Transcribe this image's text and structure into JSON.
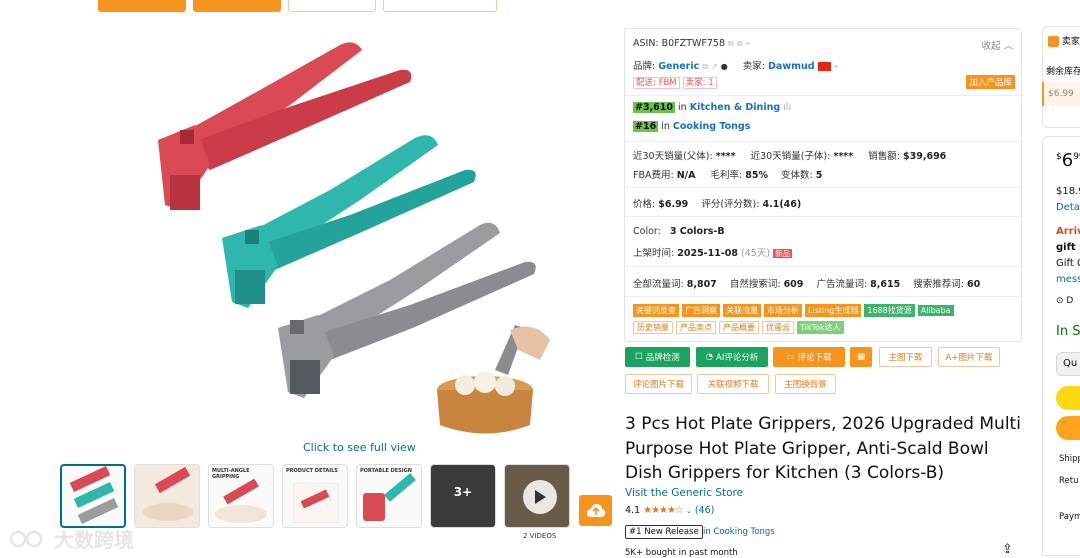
{
  "top_buttons": [
    {
      "color": "#f7941d"
    },
    {
      "color": "#f7941d"
    },
    {
      "color": "#fff"
    },
    {
      "color": "#fff"
    }
  ],
  "gallery": {
    "see_full": "Click to see full view",
    "thumbs": [
      "thumb-red-teal",
      "thumb-hand",
      "thumb-multi-angle",
      "thumb-product-details",
      "thumb-portable-design",
      "thumb-more",
      "thumb-video"
    ],
    "thumb_texts": {
      "multi_angle": "MULTI-ANGLE GRIPPING",
      "details": "PRODUCT DETAILS",
      "portable": "PORTABLE DESIGN",
      "more_count": "3+"
    },
    "videos_label": "2 VIDEOS"
  },
  "watermark": "大数跨境",
  "panel": {
    "asin_label": "ASIN: B0FZTWF758",
    "collapse": "收起",
    "brand_label": "品牌:",
    "brand_value": "Generic",
    "seller_label": "卖家:",
    "seller_value": "Dawmud",
    "ship_tag": "配送: FBM",
    "sellers_tag": "卖家: 1",
    "add_library": "加入产品库",
    "rank1_num": "#3,610",
    "rank1_in": "in",
    "rank1_cat": "Kitchen & Dining",
    "rank2_num": "#16",
    "rank2_in": "in",
    "rank2_cat": "Cooking Tongs",
    "sales30_parent_label": "近30天销量(父体):",
    "sales30_parent_value": "****",
    "sales30_child_label": "近30天销量(子体):",
    "sales30_child_value": "****",
    "revenue_label": "销售额:",
    "revenue_value": "$39,696",
    "fba_label": "FBA费用:",
    "fba_value": "N/A",
    "margin_label": "毛利率:",
    "margin_value": "85%",
    "variants_label": "变体数:",
    "variants_value": "5",
    "price_label": "价格:",
    "price_value": "$6.99",
    "rating_label": "评分(评分数):",
    "rating_value": "4.1(46)",
    "color_label": "Color:",
    "color_value": "3 Colors-B",
    "listed_label": "上架时间:",
    "listed_value": "2025-11-08",
    "listed_days": "(45天)",
    "new_tag": "新品",
    "kw_total_label": "全部流量词:",
    "kw_total_value": "8,807",
    "kw_organic_label": "自然搜索词:",
    "kw_organic_value": "609",
    "kw_ad_label": "广告流量词:",
    "kw_ad_value": "8,615",
    "kw_rec_label": "搜索推荐词:",
    "kw_rec_value": "60",
    "tags_row1": [
      "关键词反查",
      "广告洞察",
      "关联流量",
      "市场分析",
      "Listing生成器",
      "1688找货源",
      "Alibaba"
    ],
    "tags_row2": [
      "历史销量",
      "产品卖点",
      "产品概要",
      "优蛋云",
      "TikTok达人"
    ]
  },
  "actions": {
    "brand_check": "品牌检测",
    "ai_review": "AI评论分析",
    "review_download": "评论下载",
    "calc": "▦",
    "main_img_download": "主图下载",
    "aplus_download": "A+图片下载",
    "review_img_download": "评论图片下载",
    "related_video_download": "关联视频下载",
    "main_img_bg": "主图换背景"
  },
  "product": {
    "title": "3 Pcs Hot Plate Grippers, 2026 Upgraded Multi Purpose Hot Plate Gripper, Anti-Scald Bowl Dish Grippers for Kitchen (3 Colors-B)",
    "store_link": "Visit the Generic Store",
    "rating": "4.1",
    "stars": "★★★★☆",
    "rating_count": "(46)",
    "new_release": "#1 New Release",
    "new_release_in": "in Cooking Tongs",
    "bought": "5K+ bought in past month"
  },
  "right": {
    "seller_tag": "卖家",
    "stock_label": "剩余库存",
    "price_small": "$6.99",
    "price_big": "$6",
    "price_sup": "99",
    "price2": "$18.9",
    "details": "Deta",
    "arrives": "Arriv",
    "gift": "gift s",
    "gift2": "Gift C",
    "mess": "mess",
    "deliver": "D",
    "in_stock": "In S",
    "qty": "Qu",
    "ship": "Shipp",
    "ret": "Retu",
    "pay": "Paym"
  }
}
